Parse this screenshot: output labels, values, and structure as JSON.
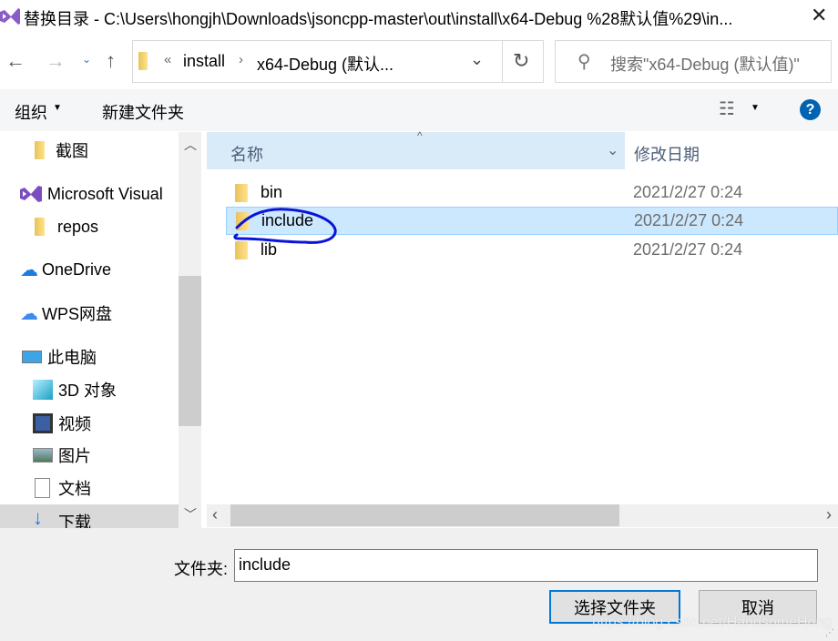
{
  "window": {
    "title": "替换目录 - C:\\Users\\hongjh\\Downloads\\jsoncpp-master\\out\\install\\x64-Debug %28默认值%29\\in...",
    "close_icon": "close-icon"
  },
  "nav": {
    "breadcrumb_overflow": "«",
    "breadcrumb": [
      "install",
      "x64-Debug (默认..."
    ],
    "search_placeholder": "搜索\"x64-Debug (默认值)\""
  },
  "toolbar": {
    "organize": "组织",
    "new_folder": "新建文件夹"
  },
  "sidebar": {
    "items": [
      {
        "label": "截图",
        "icon": "folder-icon"
      },
      {
        "label": "Microsoft Visual",
        "icon": "visual-studio-icon"
      },
      {
        "label": "repos",
        "icon": "folder-icon"
      },
      {
        "label": "OneDrive",
        "icon": "onedrive-icon"
      },
      {
        "label": "WPS网盘",
        "icon": "wps-cloud-icon"
      },
      {
        "label": "此电脑",
        "icon": "computer-icon"
      },
      {
        "label": "3D 对象",
        "icon": "3d-objects-icon"
      },
      {
        "label": "视频",
        "icon": "video-icon"
      },
      {
        "label": "图片",
        "icon": "pictures-icon"
      },
      {
        "label": "文档",
        "icon": "documents-icon"
      },
      {
        "label": "下载",
        "icon": "download-icon",
        "selected": true
      }
    ]
  },
  "list": {
    "columns": [
      "名称",
      "修改日期"
    ],
    "rows": [
      {
        "name": "bin",
        "date": "2021/2/27 0:24"
      },
      {
        "name": "include",
        "date": "2021/2/27 0:24",
        "selected": true
      },
      {
        "name": "lib",
        "date": "2021/2/27 0:24"
      }
    ]
  },
  "footer": {
    "folder_label": "文件夹:",
    "folder_value": "include",
    "select_button": "选择文件夹",
    "cancel_button": "取消"
  },
  "watermark": "https://blog.csdn.net/HandsomeHong",
  "colors": {
    "selection": "#cce8ff",
    "accent": "#0078d7",
    "annotation": "#0a14d8"
  }
}
